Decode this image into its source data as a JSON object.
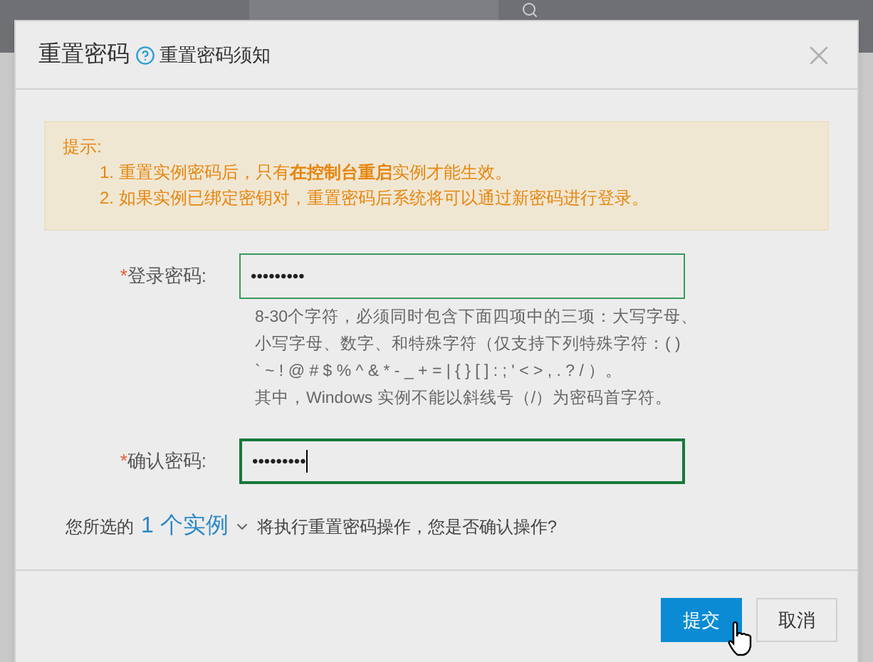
{
  "dialog": {
    "title": "重置密码",
    "help_link": "重置密码须知",
    "notice": {
      "heading": "提示:",
      "items": [
        "1. 重置实例密码后，只有**在控制台重启**实例才能生效。",
        "2. 如果实例已绑定密钥对，重置密码后系统将可以通过新密码进行登录。"
      ]
    },
    "fields": [
      {
        "required_mark": "*",
        "label": "登录密码:",
        "value": "•••••••••",
        "focused": false,
        "hint": [
          "8-30个字符，必须同时包含下面四项中的三项：大写字母、",
          "小写字母、数字、和特殊字符（仅支持下列特殊字符：( )",
          "` ~ ! @ # $ % ^ & * - _ + = | { } [ ] : ; ' < > , . ? / ）。",
          "其中，Windows 实例不能以斜线号（/）为密码首字符。"
        ]
      },
      {
        "required_mark": "*",
        "label": "确认密码:",
        "value": "•••••••••",
        "focused": true
      }
    ],
    "summary": {
      "prefix": "您所选的",
      "count_link": "1 个实例",
      "suffix": "将执行重置密码操作，您是否确认操作?"
    },
    "buttons": [
      {
        "label": "提交",
        "kind": "primary"
      },
      {
        "label": "取消",
        "kind": "secondary"
      }
    ]
  }
}
